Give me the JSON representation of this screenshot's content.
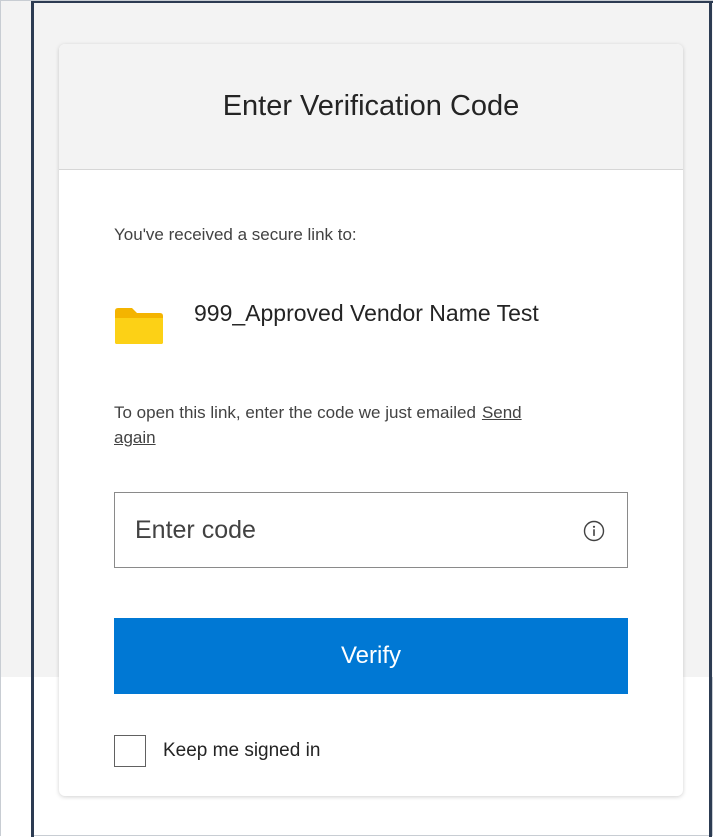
{
  "dialog": {
    "title": "Enter Verification Code",
    "intro_text": "You've received a secure link to:",
    "item": {
      "icon": "folder-icon",
      "name": "999_Approved Vendor Name Test"
    },
    "instruction_text": "To open this link, enter the code we just emailed",
    "send_again_label": "Send again",
    "code_input": {
      "value": "",
      "placeholder": "Enter code",
      "info_icon": "info-icon"
    },
    "verify_button_label": "Verify",
    "keep_signed_in": {
      "label": "Keep me signed in",
      "checked": false
    }
  },
  "colors": {
    "accent": "#0078d4",
    "header_background": "#f3f3f3",
    "folder": "#fcd116"
  }
}
